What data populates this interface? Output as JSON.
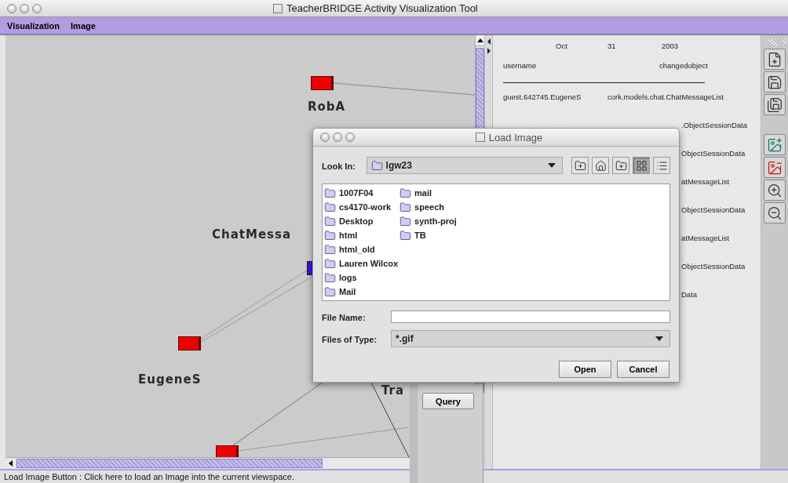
{
  "window": {
    "title": "TeacherBRIDGE Activity Visualization Tool"
  },
  "menu": [
    {
      "label": "Visualization"
    },
    {
      "label": "Image"
    }
  ],
  "graph": {
    "nodes": [
      {
        "color": "#ee0000"
      },
      {
        "color": "#2a1fe0"
      },
      {
        "color": "#ee0000"
      },
      {
        "color": "#ee0000"
      }
    ],
    "labels": [
      "RobA",
      "ChatMessa",
      "EugeneS",
      "Tra"
    ]
  },
  "log": {
    "date": [
      "Oct",
      "31",
      "2003"
    ],
    "columns": [
      "username",
      "changedobject"
    ],
    "rows": [
      {
        "kind": "full",
        "cells": [
          "guest.642745.EugeneS",
          "cork.models.chat.ChatMessageList"
        ]
      },
      {
        "kind": "partial",
        "cells": [
          ".ObjectSessionData"
        ]
      },
      {
        "kind": "partial",
        "cells": [
          "ObjectSessionData"
        ]
      },
      {
        "kind": "partial",
        "cells": [
          "atMessageList"
        ]
      },
      {
        "kind": "partial",
        "cells": [
          "ObjectSessionData"
        ]
      },
      {
        "kind": "partial",
        "cells": [
          "atMessageList"
        ]
      },
      {
        "kind": "partial",
        "cells": [
          "ObjectSessionData"
        ]
      },
      {
        "kind": "partial",
        "cells": [
          "Data"
        ]
      }
    ]
  },
  "tools": [
    {
      "kind": "new"
    },
    {
      "kind": "save"
    },
    {
      "kind": "save-as"
    },
    {
      "kind": "add-image"
    },
    {
      "kind": "remove-image"
    },
    {
      "kind": "zoom-in"
    },
    {
      "kind": "zoom-out"
    }
  ],
  "query": {
    "button": "Query"
  },
  "status_bar": "Load Image Button : Click here to load an Image into the current viewspace.",
  "dialog": {
    "title": "Load Image",
    "look_in": {
      "label": "Look In:",
      "value": "lgw23"
    },
    "view_buttons": [
      {
        "kind": "up",
        "selected": false
      },
      {
        "kind": "home",
        "selected": false
      },
      {
        "kind": "new-folder",
        "selected": false
      },
      {
        "kind": "list",
        "selected": true
      },
      {
        "kind": "details",
        "selected": false
      }
    ],
    "files": [
      "1007F04",
      "cs4170-work",
      "Desktop",
      "html",
      "html_old",
      "Lauren Wilcox",
      "logs",
      "Mail",
      "mail",
      "speech",
      "synth-proj",
      "TB"
    ],
    "file_name": {
      "label": "File Name:"
    },
    "file_type": {
      "label": "Files of Type:",
      "value": "*.gif"
    },
    "buttons": [
      "Open",
      "Cancel"
    ]
  }
}
